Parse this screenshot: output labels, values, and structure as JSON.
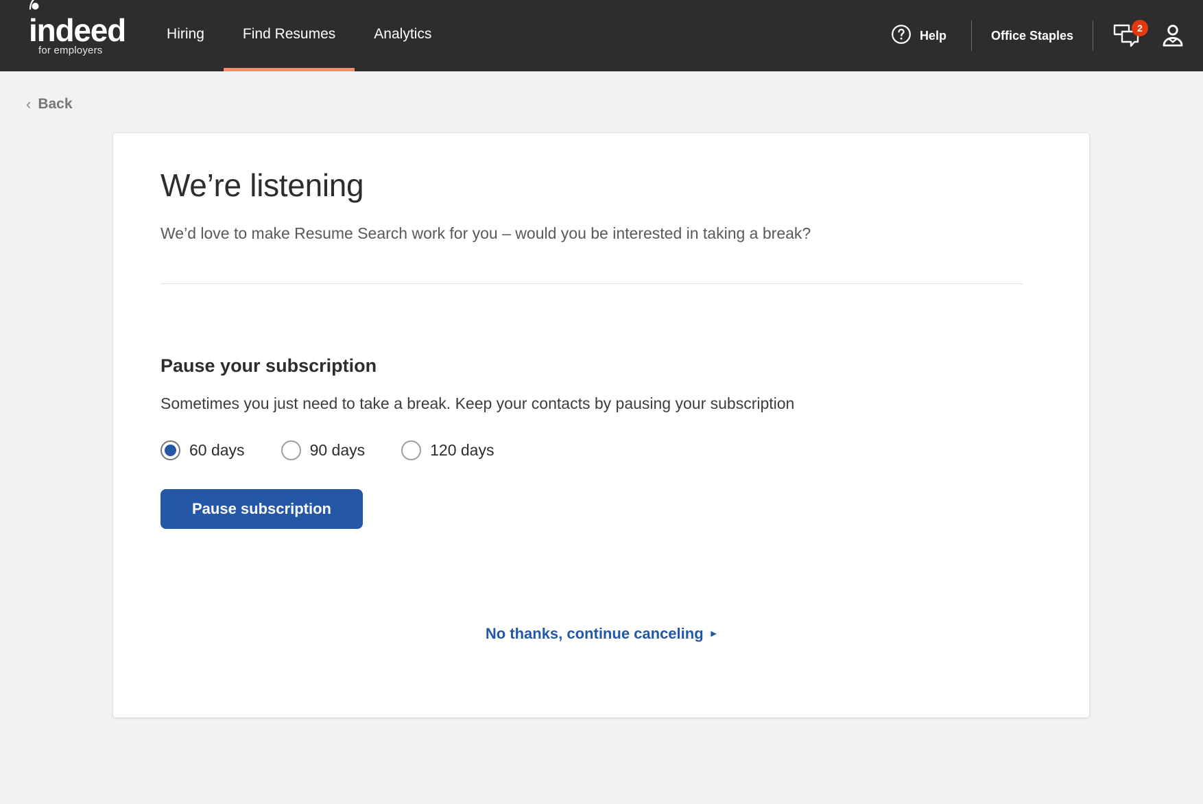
{
  "navbar": {
    "logo": {
      "word": "indeed",
      "tagline": "for employers",
      "icon": "indeed-logo"
    },
    "tabs": [
      {
        "label": "Hiring",
        "active": false
      },
      {
        "label": "Find Resumes",
        "active": true
      },
      {
        "label": "Analytics",
        "active": false
      }
    ],
    "help": {
      "label": "Help",
      "icon": "question-circle-icon"
    },
    "account_name": "Office Staples",
    "messages": {
      "icon": "messages-icon",
      "badge_count": "2"
    },
    "profile": {
      "icon": "user-avatar-icon"
    },
    "colors": {
      "background": "#2d2d2d",
      "active_tab_underline": "#ff8a66",
      "badge": "#e4390f"
    }
  },
  "back": {
    "label": "Back",
    "icon": "chevron-left-icon"
  },
  "card": {
    "title": "We’re listening",
    "subtitle": "We’d love to make Resume Search work for you – would you be interested in taking a break?",
    "section": {
      "heading": "Pause your subscription",
      "description": "Sometimes you just need to take a break. Keep your contacts by pausing your subscription",
      "options": [
        {
          "label": "60 days",
          "value": "60",
          "selected": true
        },
        {
          "label": "90 days",
          "value": "90",
          "selected": false
        },
        {
          "label": "120 days",
          "value": "120",
          "selected": false
        }
      ],
      "primary_button": "Pause subscription"
    },
    "cancel_link": {
      "label": "No thanks, continue canceling",
      "icon": "chevron-right-icon"
    },
    "accent_color": "#2557a7"
  }
}
